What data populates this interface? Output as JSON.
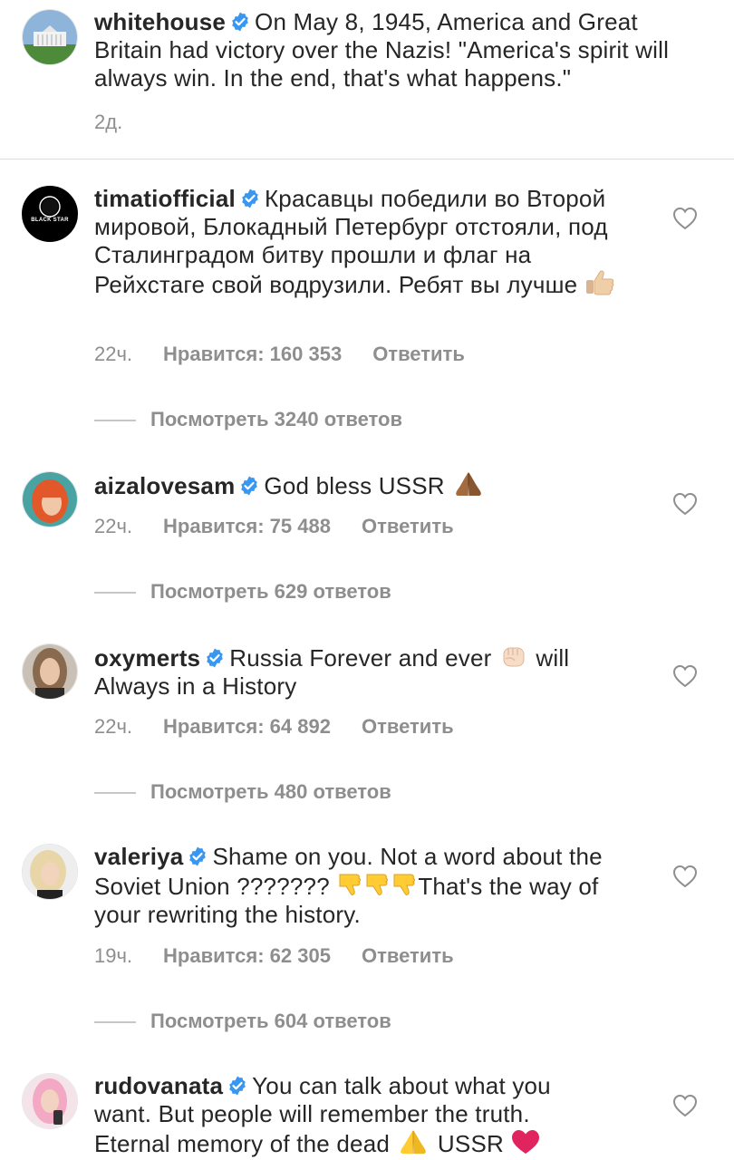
{
  "post": {
    "username": "whitehouse",
    "text": "On May 8, 1945, America and Great Britain had victory over the Nazis! \"America's spirit will always win. In the end, that's what happens.\"",
    "time": "2д."
  },
  "comments": [
    {
      "username": "timatiofficial",
      "text": "Красавцы победили во Второй мировой, Блокадный Петербург отстояли, под Сталинградом битву прошли и флаг на Рейхстаге свой водрузили. Ребят вы лучше",
      "emoji_after": "thumbs-up",
      "time": "22ч.",
      "likes": "Нравится: 160 353",
      "reply": "Ответить",
      "view_replies": "Посмотреть 3240 ответов",
      "avatar_text": "BLACK STAR"
    },
    {
      "username": "aizalovesam",
      "text": "God bless USSR",
      "emoji_after": "folded-hands",
      "time": "22ч.",
      "likes": "Нравится: 75 488",
      "reply": "Ответить",
      "view_replies": "Посмотреть 629 ответов"
    },
    {
      "username": "oxymerts",
      "text_before": "Russia Forever and ever",
      "text_after": "will Always in a History",
      "emoji_mid": "raised-fist",
      "time": "22ч.",
      "likes": "Нравится: 64 892",
      "reply": "Ответить",
      "view_replies": "Посмотреть 480 ответов"
    },
    {
      "username": "valeriya",
      "text_before": "Shame on you. Not a word about the Soviet Union ???????",
      "text_after": "That's the way of your rewriting the history.",
      "emoji_mid": "thumbs-down x3",
      "time": "19ч.",
      "likes": "Нравится: 62 305",
      "reply": "Ответить",
      "view_replies": "Посмотреть 604 ответов"
    },
    {
      "username": "rudovanata",
      "text_before": "You can talk about what you want. But people will remember the truth. Eternal memory of the dead",
      "text_after": "USSR",
      "emoji_mid": "folded-hands",
      "emoji_end": "red-heart"
    }
  ],
  "colors": {
    "verified": "#3897f0",
    "meta": "#8e8e8e",
    "text": "#262626",
    "heart_emoji": "#e0245e"
  }
}
